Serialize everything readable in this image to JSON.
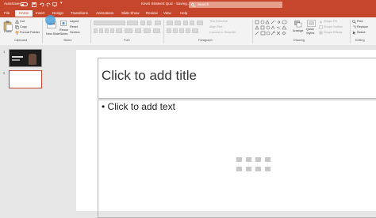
{
  "titlebar": {
    "autosave_label": "AutoSave",
    "toggle_state": "Off",
    "document_title": "Kevin Stratvert Quiz - Saving...",
    "search_placeholder": "Search"
  },
  "tabs": [
    "File",
    "Home",
    "Insert",
    "Design",
    "Transitions",
    "Animations",
    "Slide Show",
    "Review",
    "View",
    "Help"
  ],
  "active_tab": "Home",
  "ribbon": {
    "clipboard": {
      "paste": "Paste",
      "cut": "Cut",
      "copy": "Copy",
      "format_painter": "Format Painter",
      "group": "Clipboard"
    },
    "slides": {
      "new_slide": "New Slide",
      "reuse": "Reuse Slides",
      "layout": "Layout",
      "reset": "Reset",
      "section": "Section",
      "group": "Slides"
    },
    "font": {
      "group": "Font"
    },
    "paragraph": {
      "text_direction": "Text Direction",
      "align_text": "Align Text",
      "smartart": "Convert to SmartArt",
      "group": "Paragraph"
    },
    "drawing": {
      "arrange": "Arrange",
      "quick_styles": "Quick Styles",
      "shape_fill": "Shape Fill",
      "shape_outline": "Shape Outline",
      "shape_effects": "Shape Effects",
      "group": "Drawing"
    },
    "editing": {
      "find": "Find",
      "replace": "Replace",
      "select": "Select",
      "group": "Editing"
    }
  },
  "thumbnails": [
    {
      "number": "1",
      "selected": false
    },
    {
      "number": "2",
      "selected": true
    }
  ],
  "slide": {
    "title_placeholder": "Click to add title",
    "body_placeholder": "Click to add text"
  },
  "colors": {
    "accent": "#c6462b",
    "selection": "#c6462b",
    "cursor_highlight": "#4aa4de"
  }
}
